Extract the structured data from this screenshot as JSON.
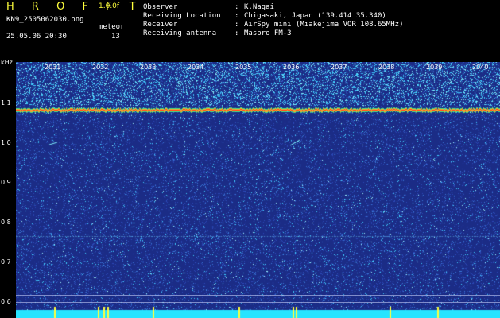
{
  "header": {
    "brand": "H R O F F T",
    "version": "1.0.0f",
    "filename": "KN9_2505062030.png",
    "datetime": "25.05.06 20:30",
    "meteor_label": "meteor",
    "meteor_count": "13"
  },
  "info": [
    {
      "key": "Observer",
      "value": "K.Nagai"
    },
    {
      "key": "Receiving Location",
      "value": "Chigasaki, Japan (139.414 35.340)"
    },
    {
      "key": "Receiver",
      "value": "AirSpy mini (Miakejima VOR 108.65MHz)"
    },
    {
      "key": "Receiving antenna",
      "value": "Maspro FM-3"
    }
  ],
  "axis": {
    "unit": "kHz",
    "y_labels": [
      "1.1",
      "1.0",
      "0.9",
      "0.8",
      "0.7",
      "0.6"
    ],
    "x_labels": [
      "2031",
      "2032",
      "2033",
      "2034",
      "2035",
      "2036",
      "2037",
      "2038",
      "2039",
      "2040"
    ]
  },
  "colors": {
    "background": "#1b2c86",
    "signal": "#ff3b1e",
    "noise": "#3fd0ff",
    "bottom_band": "#27e4ff",
    "text_yellow": "#ffff3c"
  }
}
